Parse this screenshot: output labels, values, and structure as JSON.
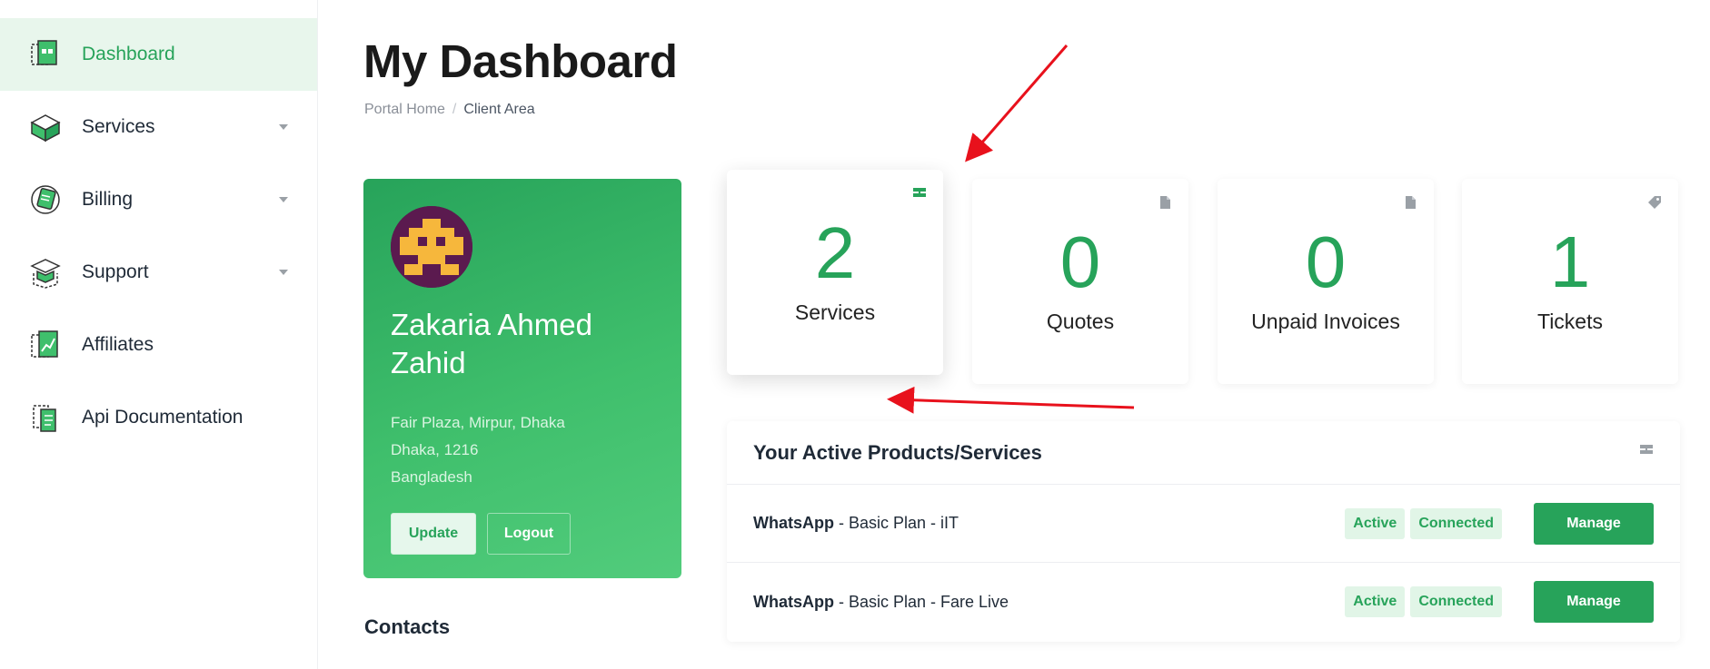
{
  "sidebar": {
    "items": [
      {
        "label": "Dashboard",
        "icon": "dashboard-icon",
        "active": true,
        "has_submenu": false
      },
      {
        "label": "Services",
        "icon": "services-box-icon",
        "active": false,
        "has_submenu": true
      },
      {
        "label": "Billing",
        "icon": "billing-icon",
        "active": false,
        "has_submenu": true
      },
      {
        "label": "Support",
        "icon": "support-icon",
        "active": false,
        "has_submenu": true
      },
      {
        "label": "Affiliates",
        "icon": "affiliates-chart-icon",
        "active": false,
        "has_submenu": false
      },
      {
        "label": "Api Documentation",
        "icon": "api-documentation-icon",
        "active": false,
        "has_submenu": false
      }
    ]
  },
  "header": {
    "title": "My Dashboard",
    "breadcrumb": {
      "home": "Portal Home",
      "separator": "/",
      "current": "Client Area"
    }
  },
  "profile": {
    "name": "Zakaria Ahmed Zahid",
    "address_line1": "Fair Plaza, Mirpur, Dhaka",
    "address_line2": "Dhaka, 1216",
    "country": "Bangladesh",
    "update_label": "Update",
    "logout_label": "Logout"
  },
  "contacts": {
    "title": "Contacts"
  },
  "stats": {
    "services": {
      "value": "2",
      "label": "Services",
      "icon": "server-icon"
    },
    "quotes": {
      "value": "0",
      "label": "Quotes",
      "icon": "document-icon"
    },
    "invoices": {
      "value": "0",
      "label": "Unpaid Invoices",
      "icon": "document-icon"
    },
    "tickets": {
      "value": "1",
      "label": "Tickets",
      "icon": "tag-icon"
    }
  },
  "products": {
    "title": "Your Active Products/Services",
    "header_icon": "server-icon",
    "rows": [
      {
        "product": "WhatsApp",
        "detail": " - Basic Plan - iIT",
        "status": "Active",
        "connection": "Connected",
        "action": "Manage"
      },
      {
        "product": "WhatsApp",
        "detail": " - Basic Plan - Fare Live",
        "status": "Active",
        "connection": "Connected",
        "action": "Manage"
      }
    ]
  },
  "colors": {
    "accent": "#27a35a",
    "sidebar_active_bg": "#e8f6ec",
    "annotation_arrow": "#e8111c",
    "avatar_bg": "#5b1a4f",
    "avatar_fg": "#f6b73c"
  }
}
